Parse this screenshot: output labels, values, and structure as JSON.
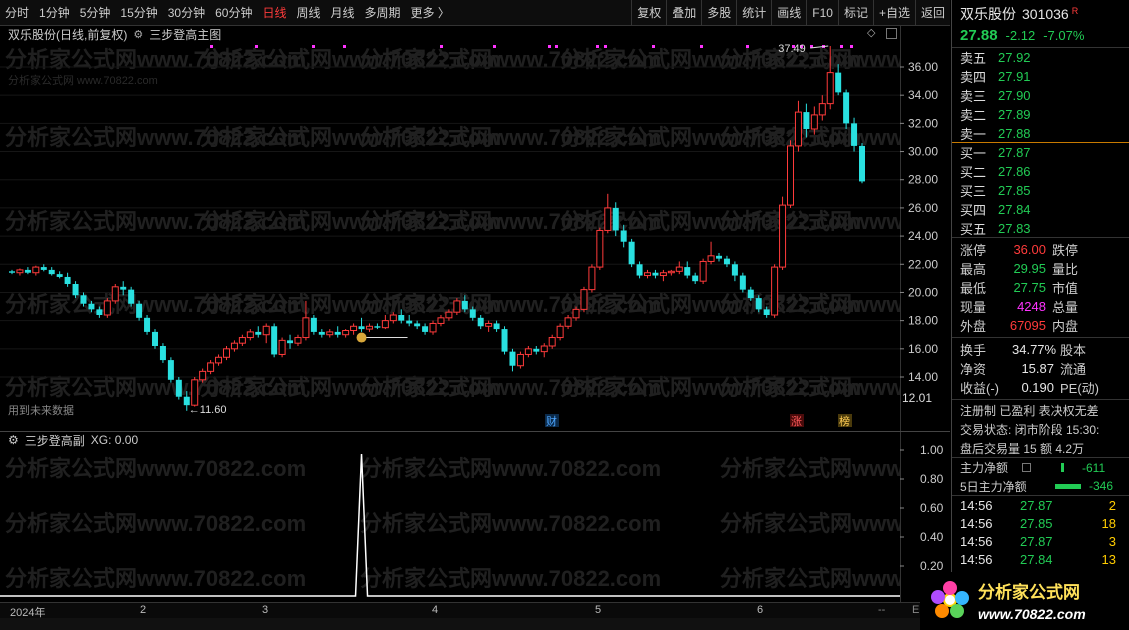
{
  "toolbar": {
    "left": [
      "分时",
      "1分钟",
      "5分钟",
      "15分钟",
      "30分钟",
      "60分钟",
      "日线",
      "周线",
      "月线",
      "多周期",
      "更多 〉"
    ],
    "active": "日线",
    "right": [
      "复权",
      "叠加",
      "多股",
      "统计",
      "画线",
      "F10",
      "标记",
      "+自选",
      "返回"
    ]
  },
  "main_head": {
    "title": "双乐股份(日线,前复权)",
    "indicator": "三步登高主图"
  },
  "main_chart": {
    "y_ticks": [
      "36.00",
      "34.00",
      "32.00",
      "30.00",
      "28.00",
      "26.00",
      "24.00",
      "22.00",
      "20.00",
      "18.00",
      "16.00",
      "14.00"
    ],
    "y_range": [
      12.0,
      38.0
    ],
    "current_label": "12.01",
    "high_label": "37.49",
    "low_label": "11.60",
    "note_text": "用到未来数据",
    "marker_cai": "财",
    "marker_zhang": "涨",
    "marker_bang": "榜",
    "watermark": "分析家公式网www.70822.com",
    "watermark_small": "分析家公式网 www.70822.com"
  },
  "sub_head": {
    "title": "三步登高副",
    "xg": "XG: 0.00"
  },
  "sub_chart": {
    "y_ticks": [
      "1.00",
      "0.80",
      "0.60",
      "0.40",
      "0.20"
    ]
  },
  "time_axis": {
    "labels": [
      "2024年",
      "2",
      "3",
      "4",
      "5",
      "6"
    ],
    "end": "--",
    "end2": "E"
  },
  "chart_data": [
    {
      "type": "candlestick",
      "title": "双乐股份(日线,前复权)",
      "ylim": [
        12.0,
        38.0
      ],
      "candles": [
        [
          21.5,
          21.6,
          21.3,
          21.4
        ],
        [
          21.4,
          21.7,
          21.2,
          21.6
        ],
        [
          21.6,
          21.8,
          21.3,
          21.4
        ],
        [
          21.4,
          21.9,
          21.2,
          21.8
        ],
        [
          21.8,
          22.0,
          21.5,
          21.6
        ],
        [
          21.6,
          21.8,
          21.2,
          21.3
        ],
        [
          21.3,
          21.5,
          21.0,
          21.1
        ],
        [
          21.1,
          21.4,
          20.4,
          20.6
        ],
        [
          20.6,
          20.8,
          19.6,
          19.8
        ],
        [
          19.8,
          20.0,
          19.0,
          19.2
        ],
        [
          19.2,
          19.4,
          18.6,
          18.8
        ],
        [
          18.8,
          19.0,
          18.2,
          18.4
        ],
        [
          18.4,
          19.6,
          18.2,
          19.4
        ],
        [
          19.4,
          20.6,
          19.2,
          20.4
        ],
        [
          20.4,
          20.8,
          19.8,
          20.2
        ],
        [
          20.2,
          20.4,
          19.0,
          19.2
        ],
        [
          19.2,
          19.4,
          18.0,
          18.2
        ],
        [
          18.2,
          18.4,
          17.0,
          17.2
        ],
        [
          17.2,
          17.4,
          16.0,
          16.2
        ],
        [
          16.2,
          16.4,
          15.0,
          15.2
        ],
        [
          15.2,
          15.4,
          13.6,
          13.8
        ],
        [
          13.8,
          14.0,
          12.4,
          12.6
        ],
        [
          12.6,
          13.0,
          11.6,
          12.0
        ],
        [
          12.0,
          14.0,
          11.9,
          13.8
        ],
        [
          13.8,
          14.6,
          13.6,
          14.4
        ],
        [
          14.4,
          15.2,
          14.2,
          15.0
        ],
        [
          15.0,
          15.6,
          14.8,
          15.4
        ],
        [
          15.4,
          16.2,
          15.2,
          16.0
        ],
        [
          16.0,
          16.6,
          15.8,
          16.4
        ],
        [
          16.4,
          17.0,
          16.2,
          16.8
        ],
        [
          16.8,
          17.4,
          16.6,
          17.2
        ],
        [
          17.2,
          17.6,
          16.8,
          17.0
        ],
        [
          17.0,
          17.8,
          16.4,
          17.6
        ],
        [
          17.6,
          17.8,
          15.4,
          15.6
        ],
        [
          15.6,
          16.8,
          15.4,
          16.6
        ],
        [
          16.6,
          17.0,
          16.0,
          16.4
        ],
        [
          16.4,
          17.0,
          16.2,
          16.8
        ],
        [
          16.8,
          19.4,
          16.6,
          18.2
        ],
        [
          18.2,
          18.4,
          17.0,
          17.2
        ],
        [
          17.2,
          17.4,
          16.8,
          17.0
        ],
        [
          17.0,
          17.4,
          16.8,
          17.2
        ],
        [
          17.2,
          17.6,
          16.8,
          17.0
        ],
        [
          17.0,
          17.4,
          16.8,
          17.3
        ],
        [
          17.3,
          17.8,
          17.0,
          17.6
        ],
        [
          17.6,
          18.2,
          17.2,
          17.4
        ],
        [
          17.4,
          17.8,
          17.2,
          17.6
        ],
        [
          17.6,
          17.8,
          17.4,
          17.5
        ],
        [
          17.5,
          18.4,
          17.4,
          18.0
        ],
        [
          18.0,
          18.6,
          17.8,
          18.4
        ],
        [
          18.4,
          18.8,
          17.8,
          18.0
        ],
        [
          18.0,
          18.4,
          17.6,
          17.8
        ],
        [
          17.8,
          18.0,
          17.4,
          17.6
        ],
        [
          17.6,
          17.8,
          17.0,
          17.2
        ],
        [
          17.2,
          18.0,
          17.0,
          17.8
        ],
        [
          17.8,
          18.4,
          17.6,
          18.2
        ],
        [
          18.2,
          18.8,
          18.0,
          18.6
        ],
        [
          18.6,
          19.6,
          18.4,
          19.4
        ],
        [
          19.4,
          19.8,
          18.6,
          18.8
        ],
        [
          18.8,
          19.0,
          18.0,
          18.2
        ],
        [
          18.2,
          18.4,
          17.4,
          17.6
        ],
        [
          17.6,
          18.0,
          17.2,
          17.8
        ],
        [
          17.8,
          18.0,
          17.2,
          17.4
        ],
        [
          17.4,
          17.6,
          15.6,
          15.8
        ],
        [
          15.8,
          16.0,
          14.4,
          14.8
        ],
        [
          14.8,
          15.8,
          14.6,
          15.6
        ],
        [
          15.6,
          16.2,
          15.4,
          16.0
        ],
        [
          16.0,
          16.2,
          15.6,
          15.8
        ],
        [
          15.8,
          16.4,
          15.4,
          16.2
        ],
        [
          16.2,
          17.0,
          16.0,
          16.8
        ],
        [
          16.8,
          17.8,
          16.6,
          17.6
        ],
        [
          17.6,
          18.4,
          17.4,
          18.2
        ],
        [
          18.2,
          19.0,
          18.0,
          18.8
        ],
        [
          18.8,
          20.4,
          18.6,
          20.2
        ],
        [
          20.2,
          22.0,
          20.0,
          21.8
        ],
        [
          21.8,
          24.6,
          21.6,
          24.4
        ],
        [
          24.4,
          27.0,
          24.2,
          26.0
        ],
        [
          26.0,
          26.4,
          24.0,
          24.4
        ],
        [
          24.4,
          24.8,
          23.2,
          23.6
        ],
        [
          23.6,
          23.8,
          21.8,
          22.0
        ],
        [
          22.0,
          22.2,
          21.0,
          21.2
        ],
        [
          21.2,
          21.6,
          21.0,
          21.4
        ],
        [
          21.4,
          21.6,
          21.0,
          21.2
        ],
        [
          21.2,
          21.6,
          20.8,
          21.4
        ],
        [
          21.4,
          21.6,
          21.2,
          21.5
        ],
        [
          21.5,
          22.2,
          21.3,
          21.8
        ],
        [
          21.8,
          22.2,
          21.0,
          21.2
        ],
        [
          21.2,
          21.4,
          20.6,
          20.8
        ],
        [
          20.8,
          22.4,
          20.6,
          22.2
        ],
        [
          22.2,
          23.6,
          22.0,
          22.6
        ],
        [
          22.6,
          22.8,
          22.2,
          22.4
        ],
        [
          22.4,
          22.6,
          21.8,
          22.0
        ],
        [
          22.0,
          22.2,
          20.8,
          21.2
        ],
        [
          21.2,
          21.4,
          20.0,
          20.2
        ],
        [
          20.2,
          20.4,
          19.4,
          19.6
        ],
        [
          19.6,
          19.8,
          18.6,
          18.8
        ],
        [
          18.8,
          19.0,
          18.2,
          18.4
        ],
        [
          18.4,
          22.0,
          18.2,
          21.8
        ],
        [
          21.8,
          26.8,
          21.6,
          26.2
        ],
        [
          26.2,
          30.8,
          26.0,
          30.4
        ],
        [
          30.4,
          33.6,
          30.0,
          32.8
        ],
        [
          32.8,
          33.4,
          31.0,
          31.6
        ],
        [
          31.6,
          33.2,
          31.2,
          32.6
        ],
        [
          32.6,
          34.0,
          32.2,
          33.4
        ],
        [
          33.4,
          37.49,
          33.0,
          35.6
        ],
        [
          35.6,
          36.2,
          34.0,
          34.2
        ],
        [
          34.2,
          34.4,
          31.6,
          32.0
        ],
        [
          32.0,
          32.4,
          30.0,
          30.4
        ],
        [
          30.4,
          30.6,
          27.75,
          27.88
        ]
      ],
      "annotations": [
        "37.49",
        "11.60",
        "用到未来数据",
        "财",
        "涨",
        "榜"
      ]
    },
    {
      "type": "line",
      "title": "三步登高副",
      "ylim": [
        0,
        1.0
      ],
      "series": [
        {
          "name": "XG",
          "spike_index": 44,
          "spike_value": 1.0,
          "base_value": 0.0
        }
      ]
    }
  ],
  "side": {
    "name": "双乐股份",
    "code": "301036",
    "r_badge": "R",
    "price": "27.88",
    "change": "-2.12",
    "pct": "-7.07%",
    "asks": [
      [
        "卖五",
        "27.92"
      ],
      [
        "卖四",
        "27.91"
      ],
      [
        "卖三",
        "27.90"
      ],
      [
        "卖二",
        "27.89"
      ],
      [
        "卖一",
        "27.88"
      ]
    ],
    "bids": [
      [
        "买一",
        "27.87"
      ],
      [
        "买二",
        "27.86"
      ],
      [
        "买三",
        "27.85"
      ],
      [
        "买四",
        "27.84"
      ],
      [
        "买五",
        "27.83"
      ]
    ],
    "stats1": [
      [
        "涨停",
        "36.00",
        "跌停"
      ],
      [
        "最高",
        "29.95",
        "量比"
      ],
      [
        "最低",
        "27.75",
        "市值"
      ],
      [
        "现量",
        "4248",
        "总量"
      ],
      [
        "外盘",
        "67095",
        "内盘"
      ]
    ],
    "stats2": [
      [
        "换手",
        "34.77%",
        "股本"
      ],
      [
        "净资",
        "15.87",
        "流通"
      ],
      [
        "收益(-)",
        "0.190",
        "PE(动)"
      ]
    ],
    "reg": "注册制  已盈利  表决权无差",
    "trade_state": "交易状态: 闭市阶段 15:30:",
    "after": "盘后交易量 15  额 4.2万",
    "main_net": {
      "label": "主力净额",
      "value": "-611"
    },
    "main_net5": {
      "label": "5日主力净额",
      "value": "-346"
    },
    "ticks": [
      [
        "14:56",
        "27.87",
        "2"
      ],
      [
        "14:56",
        "27.85",
        "18"
      ],
      [
        "14:56",
        "27.87",
        "3"
      ],
      [
        "14:56",
        "27.84",
        "13"
      ]
    ]
  },
  "logo": {
    "text": "分析家公式网",
    "url": "www.70822.com"
  },
  "colors": {
    "up": "#ff3b3b",
    "down": "#29e0e0",
    "magenta": "#ff33ff",
    "green": "#22cc55"
  }
}
